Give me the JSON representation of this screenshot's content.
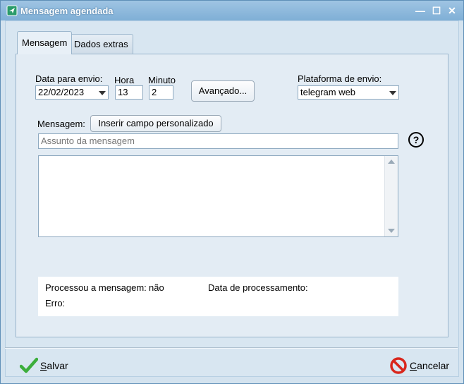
{
  "window": {
    "title": "Mensagem agendada",
    "controls": {
      "minimize": "—",
      "maximize": "☐",
      "close": "✕"
    }
  },
  "tabs": [
    {
      "label": "Mensagem",
      "active": true
    },
    {
      "label": "Dados extras",
      "active": false
    }
  ],
  "form": {
    "date_label": "Data para envio:",
    "date_value": "22/02/2023",
    "hour_label": "Hora",
    "hour_value": "13",
    "minute_label": "Minuto",
    "minute_value": "2",
    "advanced_label": "Avançado...",
    "platform_label": "Plataforma de envio:",
    "platform_value": "telegram web",
    "message_label": "Mensagem:",
    "insert_field_label": "Inserir campo personalizado",
    "subject_placeholder": "Assunto da mensagem",
    "help_label": "?"
  },
  "status": {
    "processed_label": "Processou a mensagem:",
    "processed_value": "não",
    "processed_date_label": "Data de processamento:",
    "error_label": "Erro:"
  },
  "footer": {
    "save_label_first": "S",
    "save_label_rest": "alvar",
    "cancel_label_first": "C",
    "cancel_label_rest": "ancelar"
  },
  "colors": {
    "titlebar": "#8bb8dc",
    "panel": "#e3ecf4",
    "save_icon": "#3cae3c",
    "cancel_icon": "#d9261c"
  }
}
